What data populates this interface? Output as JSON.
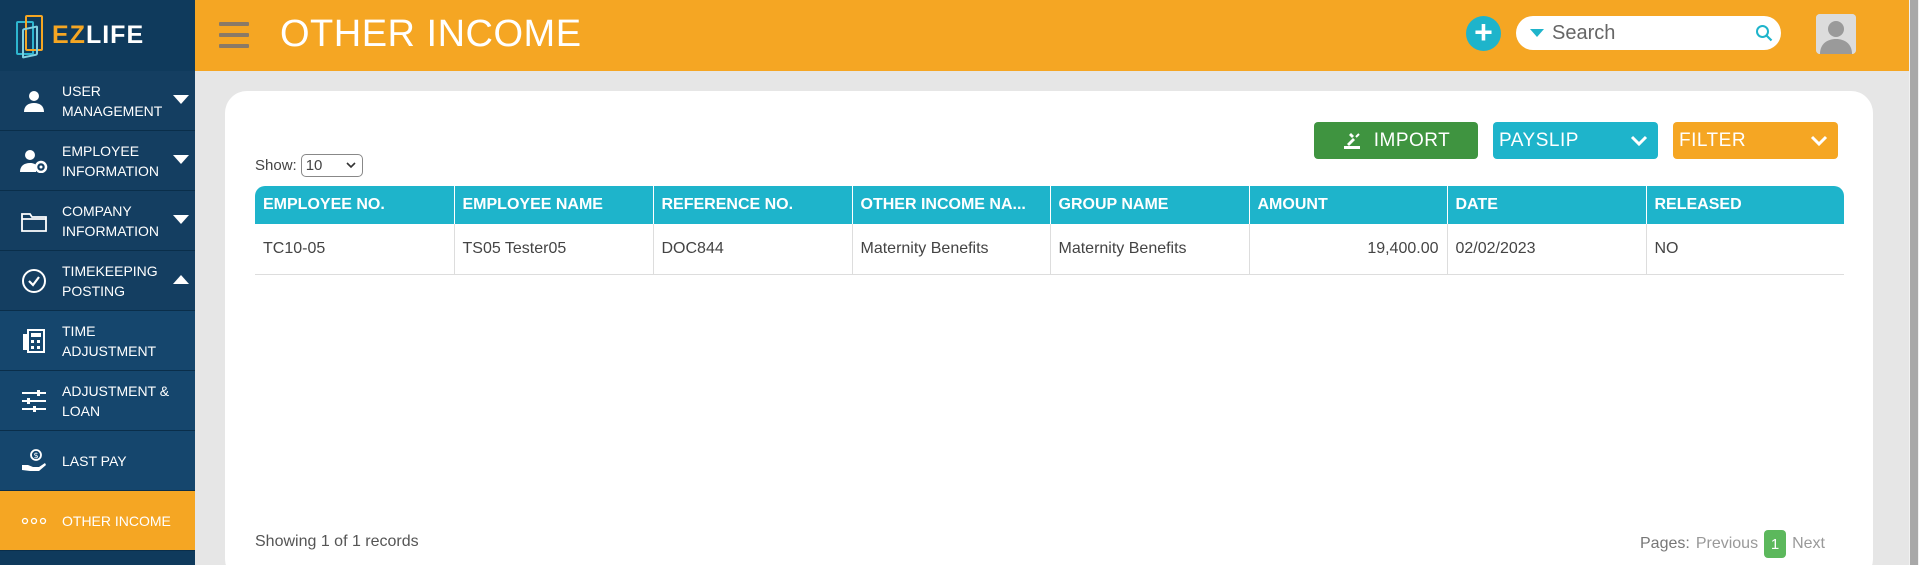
{
  "logo": {
    "part1": "EZ",
    "part2": "LIFE"
  },
  "header": {
    "title": "OTHER INCOME",
    "search_placeholder": "Search"
  },
  "sidebar": {
    "items": [
      {
        "label_line1": "USER",
        "label_line2": "MANAGEMENT",
        "icon": "user-icon",
        "caret": "down"
      },
      {
        "label_line1": "EMPLOYEE",
        "label_line2": "INFORMATION",
        "icon": "employee-settings-icon",
        "caret": "down"
      },
      {
        "label_line1": "COMPANY",
        "label_line2": "INFORMATION",
        "icon": "folder-icon",
        "caret": "down"
      },
      {
        "label_line1": "TIMEKEEPING",
        "label_line2": "POSTING",
        "icon": "check-circle-icon",
        "caret": "up"
      },
      {
        "label_line1": "TIME",
        "label_line2": "ADJUSTMENT",
        "icon": "calculator-icon"
      },
      {
        "label_line1": "ADJUSTMENT &",
        "label_line2": "LOAN",
        "icon": "sliders-icon"
      },
      {
        "label_line1": "LAST PAY",
        "label_line2": "",
        "icon": "hand-money-icon"
      },
      {
        "label_line1": "OTHER INCOME",
        "label_line2": "",
        "icon": "dots-icon"
      }
    ]
  },
  "toolbar": {
    "import_label": "IMPORT",
    "payslip_label": "PAYSLIP",
    "filter_label": "FILTER",
    "show_label": "Show:",
    "show_value": "10"
  },
  "table": {
    "headers": [
      "EMPLOYEE NO.",
      "EMPLOYEE NAME",
      "REFERENCE NO.",
      "OTHER INCOME NA...",
      "GROUP NAME",
      "AMOUNT",
      "DATE",
      "RELEASED"
    ],
    "rows": [
      [
        "TC10-05",
        "TS05 Tester05",
        "DOC844",
        "Maternity Benefits",
        "Maternity Benefits",
        "19,400.00",
        "02/02/2023",
        "NO"
      ]
    ]
  },
  "footer": {
    "records_text": "Showing 1 of 1 records",
    "pages_label": "Pages:",
    "previous_label": "Previous",
    "current_page": "1",
    "next_label": "Next"
  },
  "colors": {
    "accent_orange": "#f5a623",
    "accent_teal": "#1eb4cb",
    "sidebar_navy": "#0f3a5c",
    "import_green": "#3f9440"
  }
}
